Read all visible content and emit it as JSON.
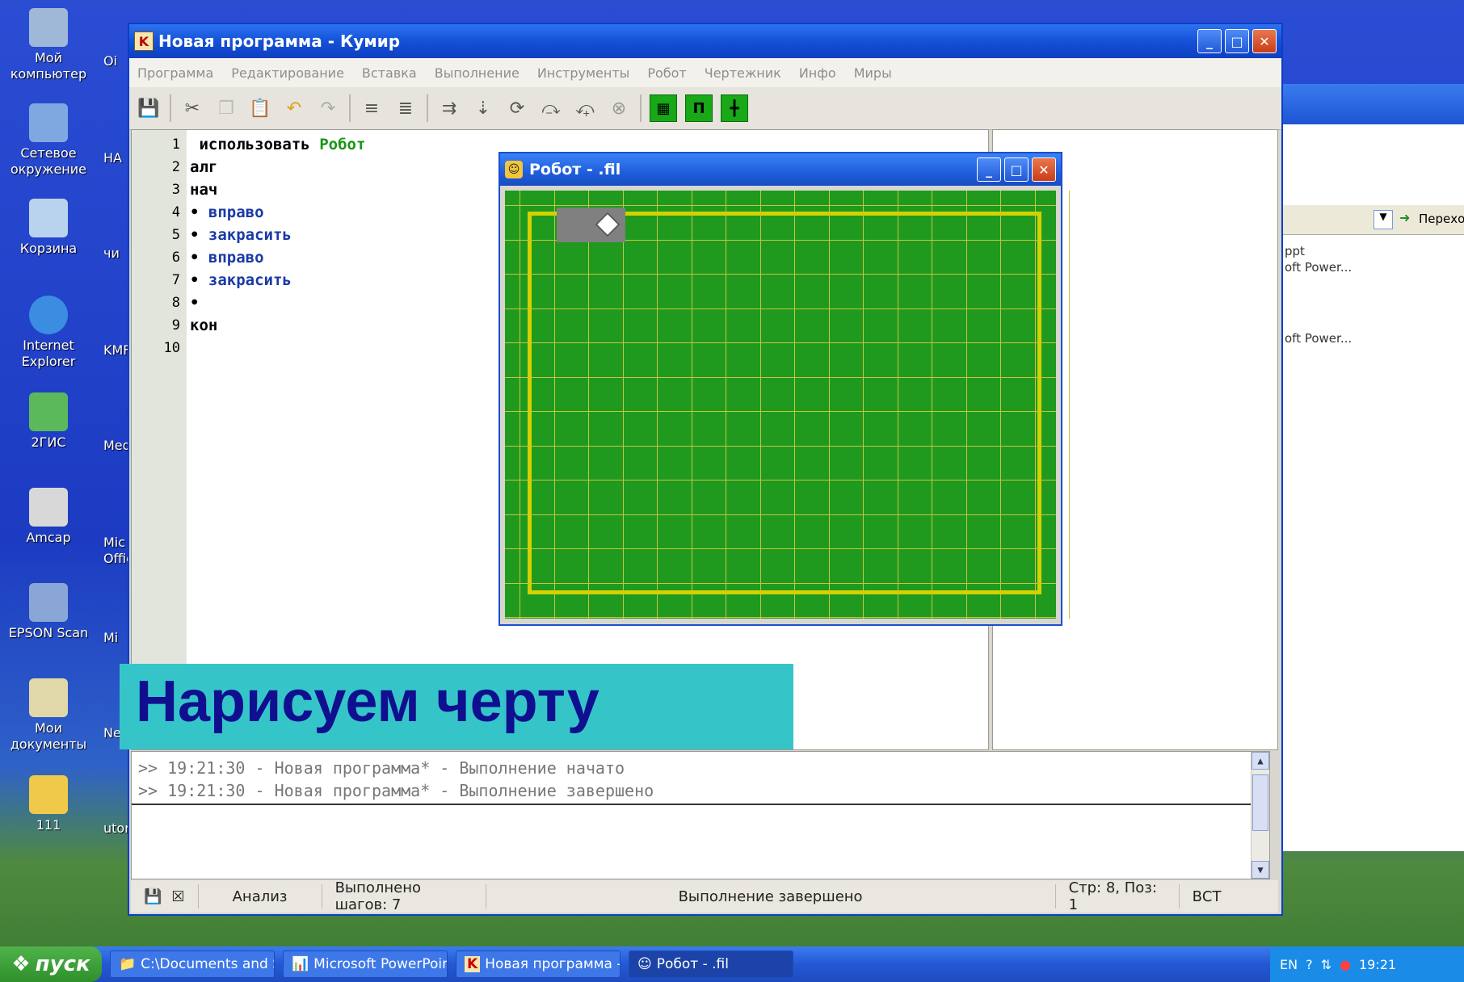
{
  "desktop": {
    "icons": [
      {
        "label": "Мой компьютер",
        "icon": "computer-icon"
      },
      {
        "label": "Сетевое окружение",
        "icon": "network-icon"
      },
      {
        "label": "Корзина",
        "icon": "recycle-bin-icon"
      },
      {
        "label": "Internet Explorer",
        "icon": "ie-icon"
      },
      {
        "label": "2ГИС",
        "icon": "2gis-icon"
      },
      {
        "label": "Amcap",
        "icon": "amcap-icon"
      },
      {
        "label": "EPSON Scan",
        "icon": "scanner-icon"
      },
      {
        "label": "Мои документы",
        "icon": "my-documents-icon"
      },
      {
        "label": "111",
        "icon": "folder-icon"
      }
    ],
    "col2": [
      "Оi",
      "НА",
      "чи",
      "KMF",
      "Med",
      "Mic Office",
      "Mi",
      "Nero",
      "utorr"
    ]
  },
  "window": {
    "title": "Новая программа - Кумир",
    "icon_letter": "K",
    "menu": [
      "Программа",
      "Редактирование",
      "Вставка",
      "Выполнение",
      "Инструменты",
      "Робот",
      "Чертежник",
      "Инфо",
      "Миры"
    ]
  },
  "editor": {
    "lines": [
      {
        "n": "1",
        "text": "использовать",
        "extra": "Робот",
        "indent": " "
      },
      {
        "n": "2",
        "text": "алг"
      },
      {
        "n": "3",
        "text": "нач"
      },
      {
        "n": "4",
        "text": "вправо",
        "bullet": "•"
      },
      {
        "n": "5",
        "text": "закрасить",
        "bullet": "•"
      },
      {
        "n": "6",
        "text": "вправо",
        "bullet": "•"
      },
      {
        "n": "7",
        "text": "закрасить",
        "bullet": "•"
      },
      {
        "n": "8",
        "text": "",
        "bullet": "•"
      },
      {
        "n": "9",
        "text": "кон"
      },
      {
        "n": "10",
        "text": ""
      }
    ]
  },
  "robot_window": {
    "title": "Робот - .fil",
    "painted_cells": [
      [
        1,
        0
      ]
    ],
    "robot_cell": [
      2,
      0
    ]
  },
  "output": {
    "lines": [
      ">> 19:21:30 - Новая программа* - Выполнение начато",
      ">> 19:21:30 - Новая программа* - Выполнение завершено"
    ]
  },
  "status": {
    "mode": "Анализ",
    "steps": "Выполнено шагов: 7",
    "state": "Выполнение завершено",
    "position": "Стр: 8, Поз: 1",
    "insert": "ВСТ"
  },
  "bg_window": {
    "go_label": "Перехо",
    "item1a": "ppt",
    "item1b": "oft Power...",
    "item2": "oft Power..."
  },
  "banner": {
    "text": "Нарисуем черту"
  },
  "taskbar": {
    "start": "пуск",
    "tasks": [
      "C:\\Documents and Se...",
      "Microsoft PowerPoint ...",
      "Новая программа - К...",
      "Робот - .fil"
    ],
    "lang": "EN",
    "clock": "19:21"
  }
}
